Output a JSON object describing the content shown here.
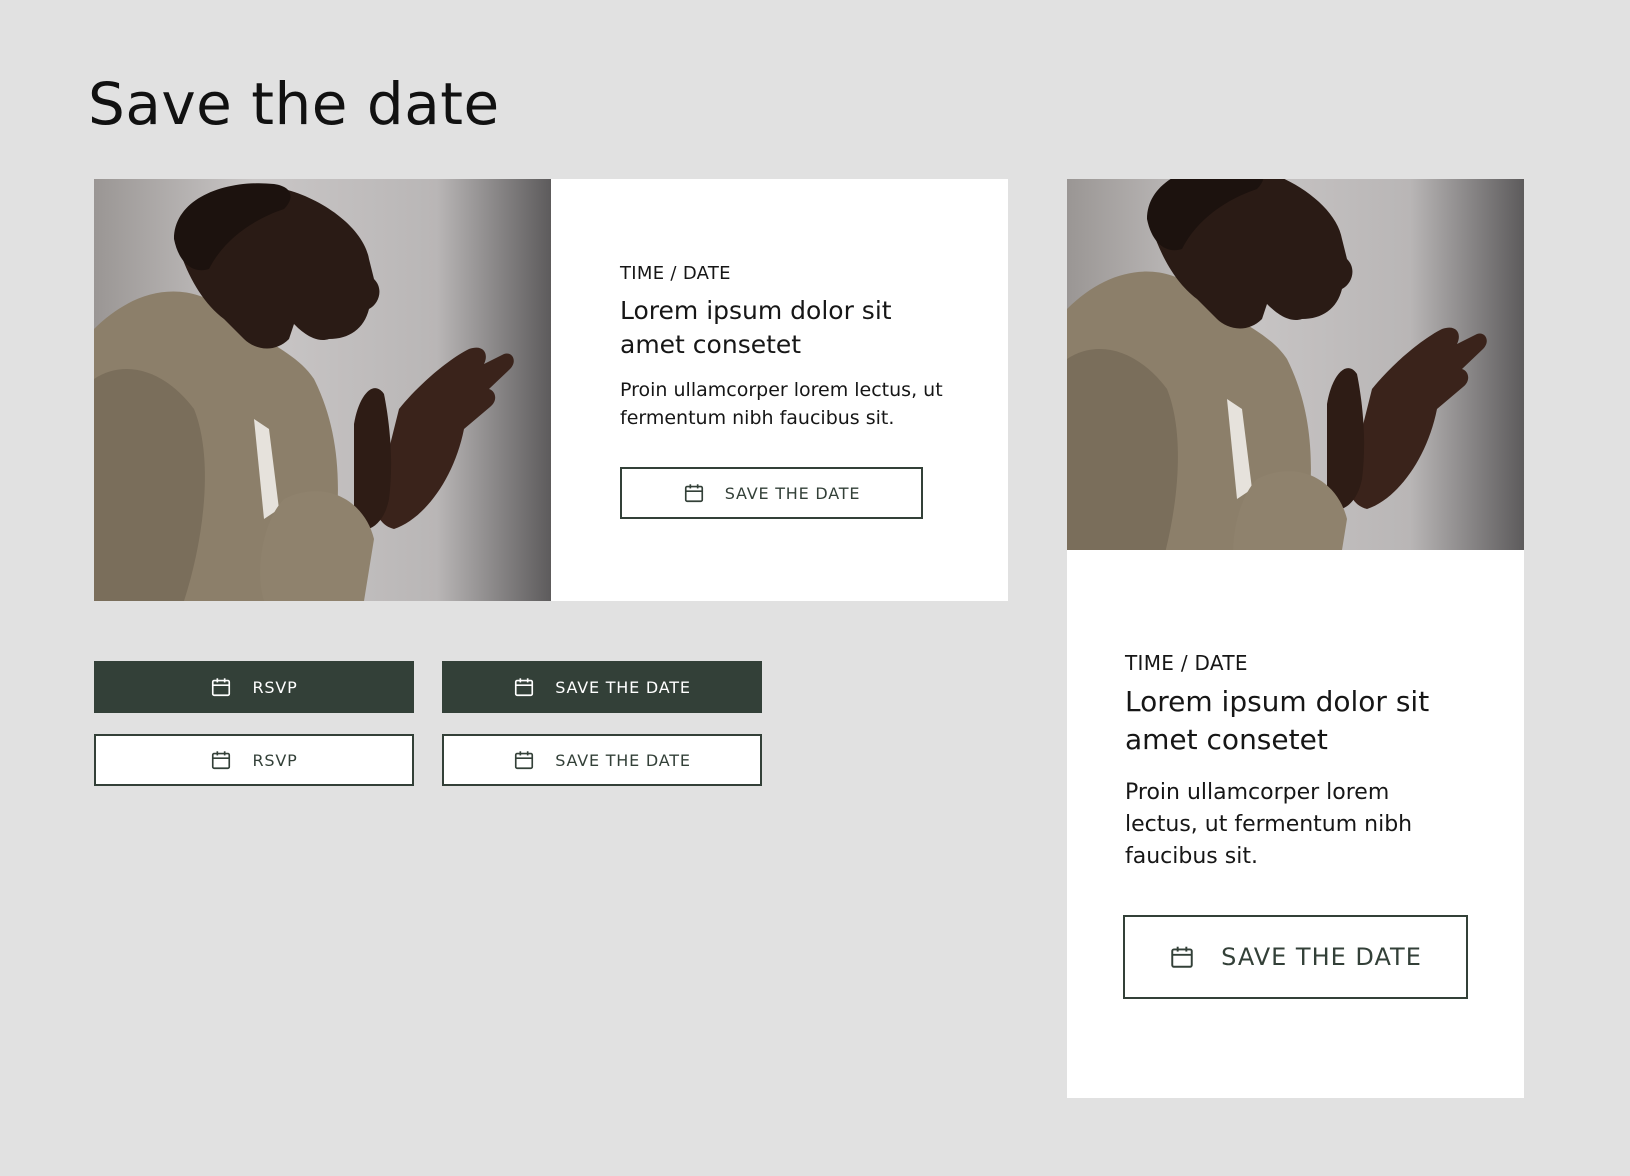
{
  "page": {
    "title": "Save the date"
  },
  "horizontal_card": {
    "image": "portrait-photo",
    "eyebrow": "TIME / DATE",
    "headline": "Lorem ipsum dolor sit amet consetet",
    "body": "Proin ullamcorper lorem lectus, ut fermentum nibh faucibus sit.",
    "button_label": "SAVE THE DATE",
    "button_icon": "calendar-icon"
  },
  "vertical_card": {
    "image": "portrait-photo",
    "eyebrow": "TIME / DATE",
    "headline": "Lorem ipsum dolor sit amet consetet",
    "body": "Proin ullamcorper lorem lectus, ut fermentum nibh faucibus sit.",
    "button_label": "SAVE THE DATE",
    "button_icon": "calendar-icon"
  },
  "buttons": {
    "rsvp_solid": "RSVP",
    "save_solid": "SAVE THE DATE",
    "rsvp_outline": "RSVP",
    "save_outline": "SAVE THE DATE"
  },
  "colors": {
    "background": "#e1e1e1",
    "card": "#ffffff",
    "accent": "#334038",
    "text": "#161616"
  }
}
